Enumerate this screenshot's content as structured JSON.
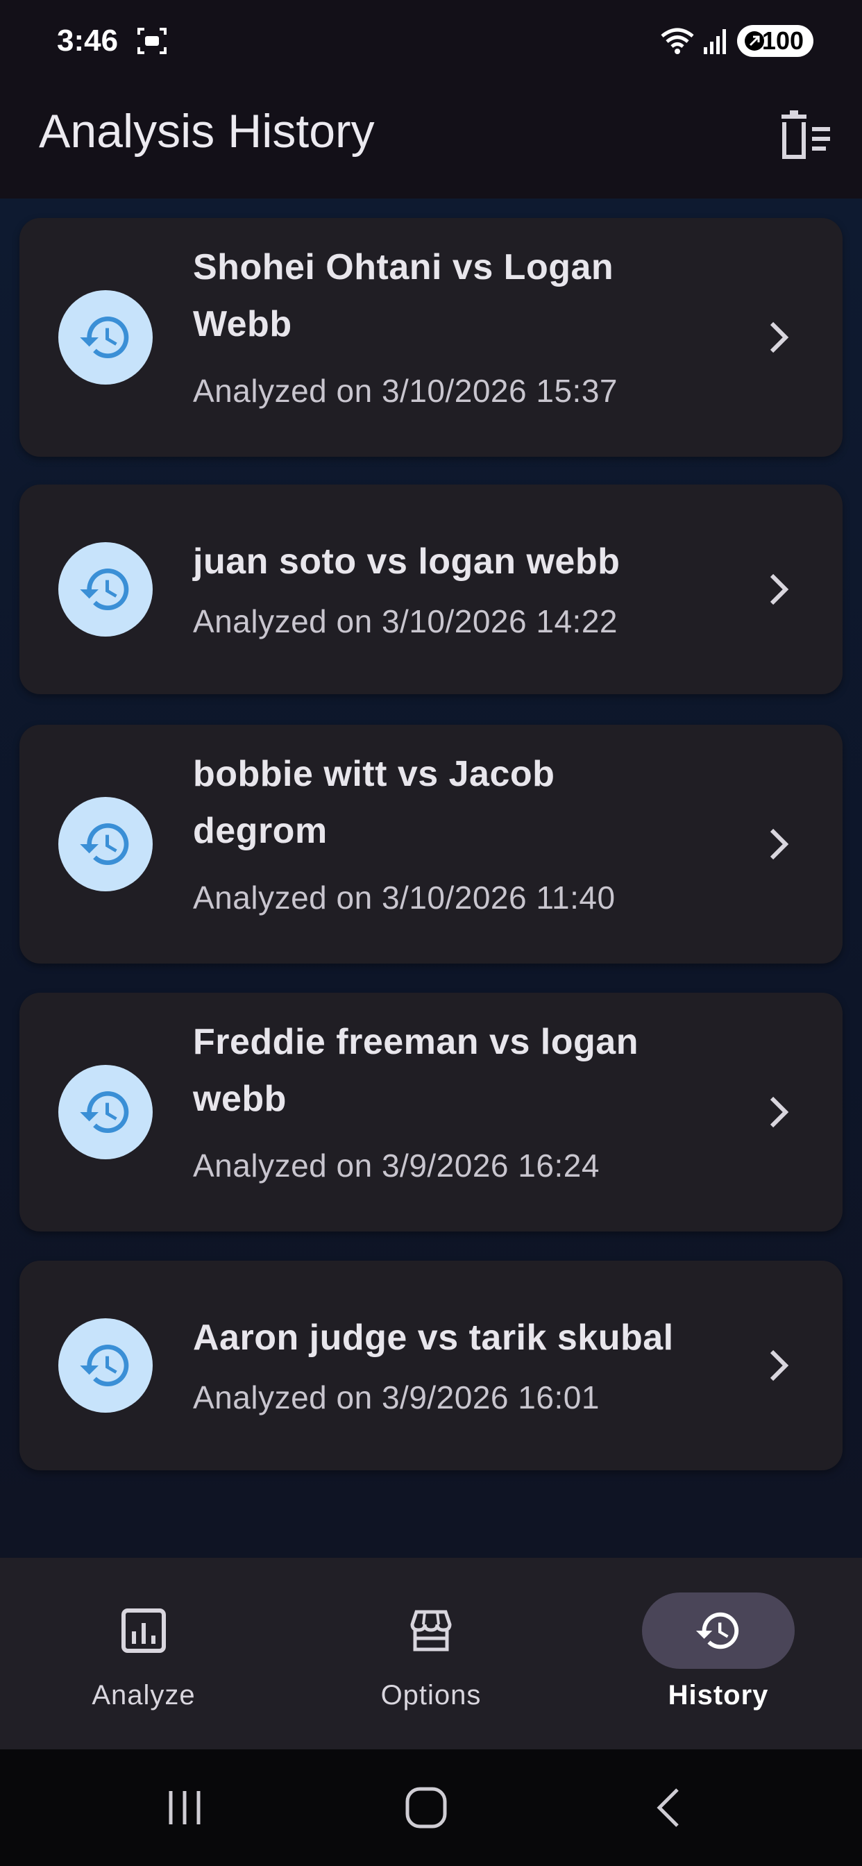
{
  "status_bar": {
    "time": "3:46",
    "battery": "100"
  },
  "app_bar": {
    "title": "Analysis History",
    "clear_icon": "clear-all-icon"
  },
  "history": [
    {
      "title": "Shohei Ohtani vs Logan Webb",
      "subtitle": "Analyzed on 3/10/2026 15:37"
    },
    {
      "title": "juan soto vs logan webb",
      "subtitle": "Analyzed on 3/10/2026 14:22"
    },
    {
      "title": "bobbie witt vs Jacob degrom",
      "subtitle": "Analyzed on 3/10/2026 11:40"
    },
    {
      "title": "Freddie freeman vs logan webb",
      "subtitle": "Analyzed on 3/9/2026 16:24"
    },
    {
      "title": "Aaron judge vs tarik skubal",
      "subtitle": "Analyzed on 3/9/2026 16:01"
    }
  ],
  "bottom_nav": [
    {
      "label": "Analyze",
      "icon": "bar-chart-icon",
      "active": false
    },
    {
      "label": "Options",
      "icon": "storefront-icon",
      "active": false
    },
    {
      "label": "History",
      "icon": "history-icon",
      "active": true
    }
  ],
  "colors": {
    "background": "#131018",
    "card": "#201e24",
    "avatar_bg": "#c7e3fb",
    "avatar_icon": "#3a8fd6",
    "nav_active_pill": "#4a4558"
  }
}
